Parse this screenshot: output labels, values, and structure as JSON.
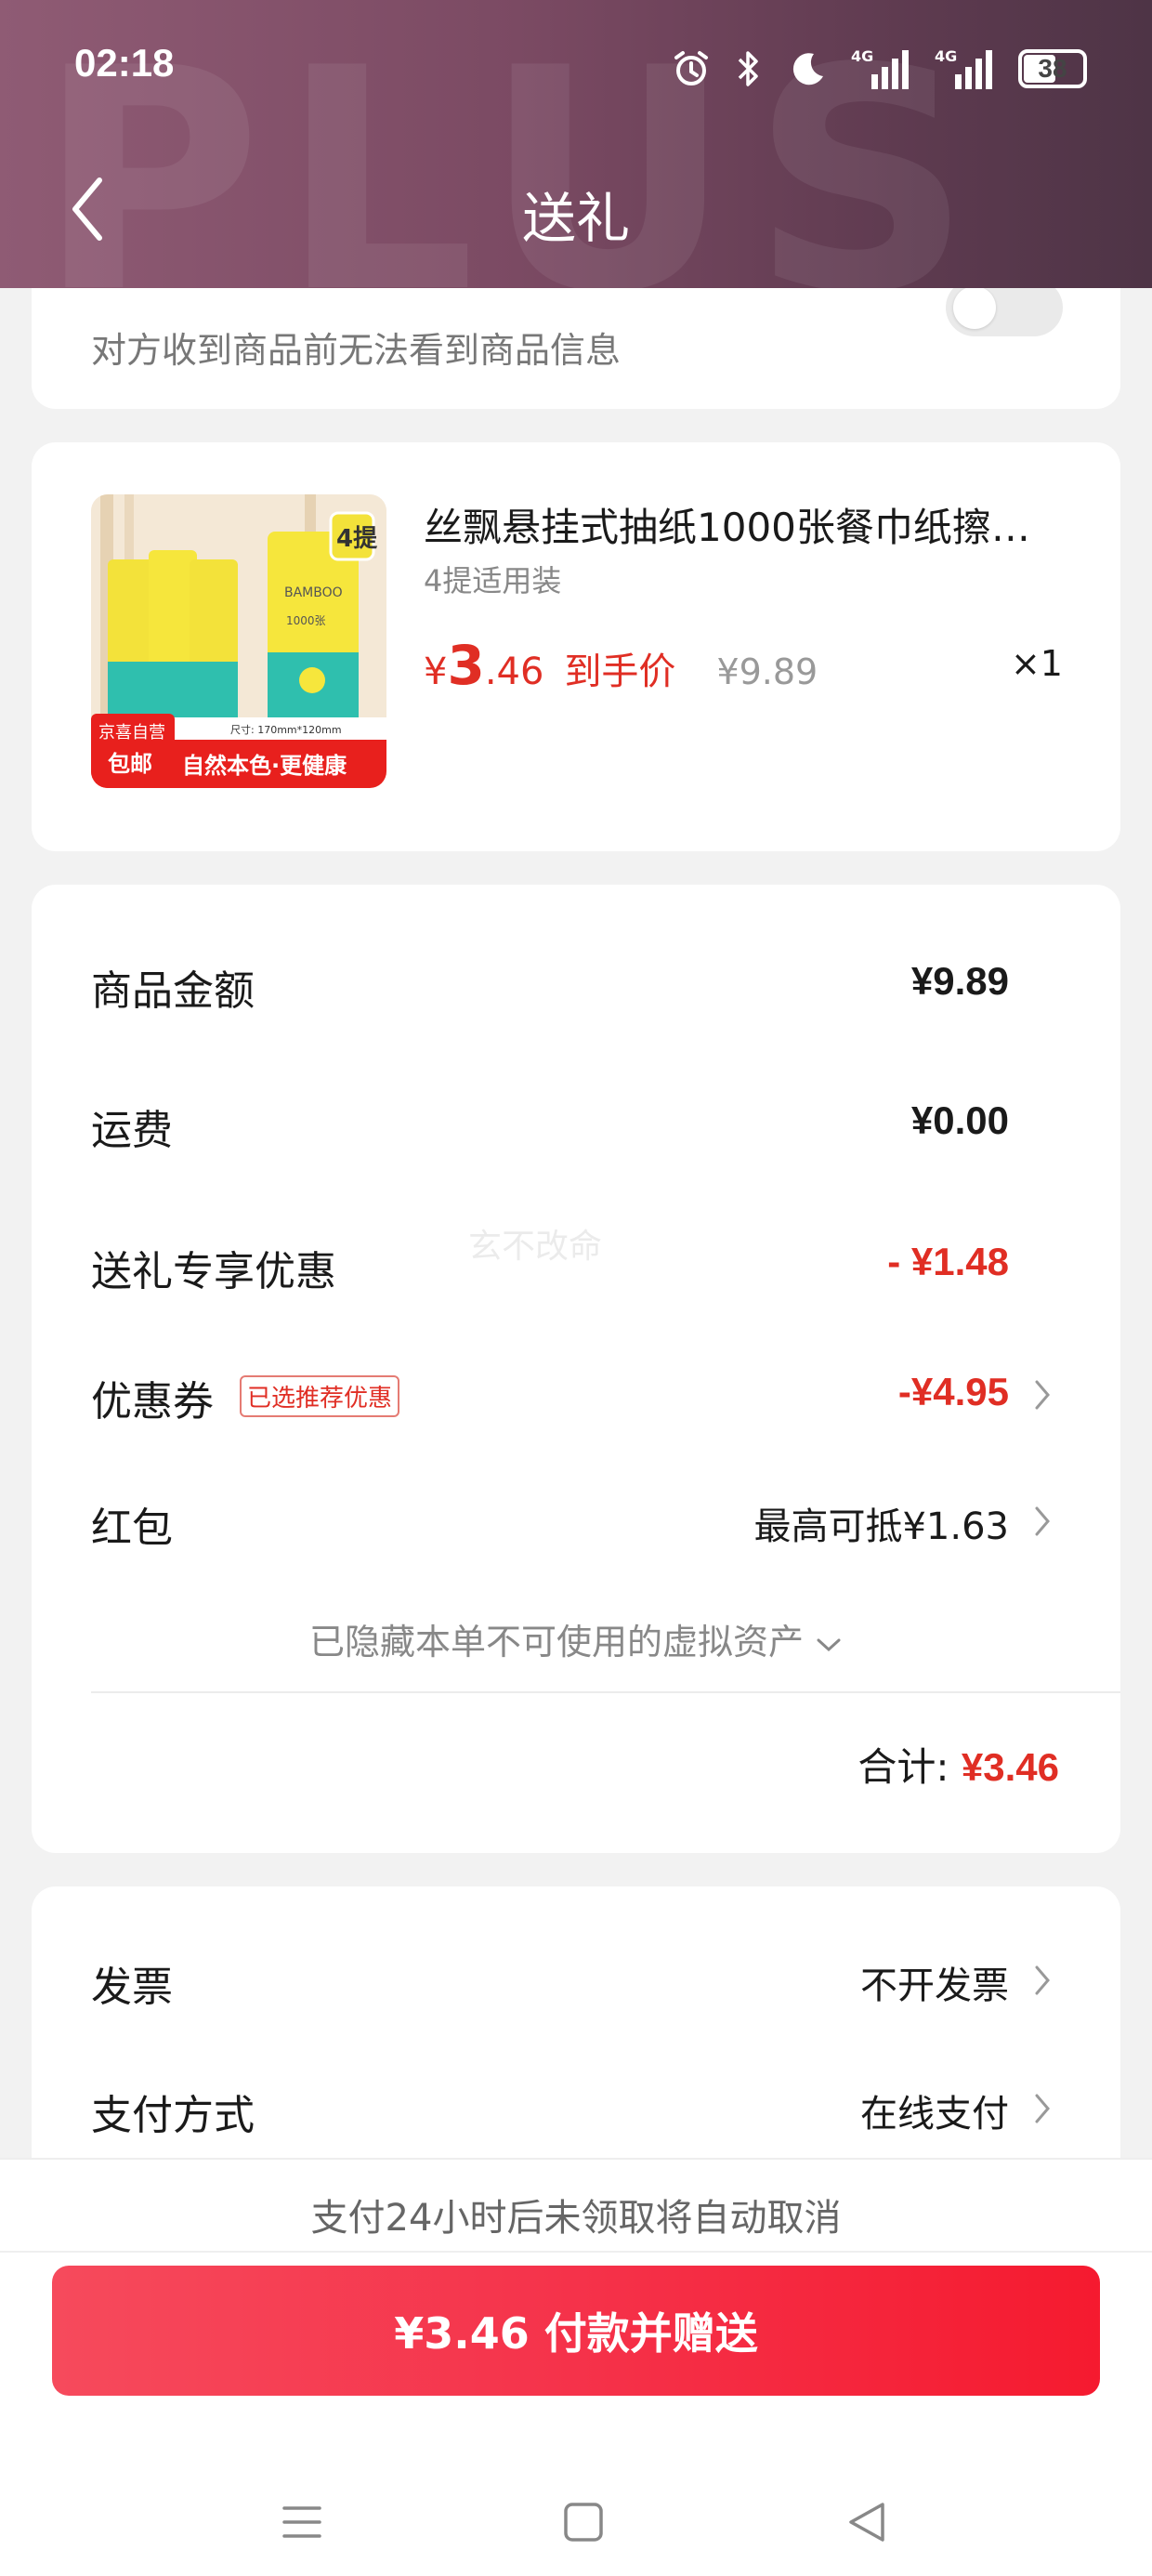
{
  "status_bar": {
    "time": "02:18",
    "network_1": "4G",
    "network_2": "4G",
    "battery": "38"
  },
  "header": {
    "title": "送礼",
    "watermark": "PLUS"
  },
  "privacy_card": {
    "hint": "对方收到商品前无法看到商品信息",
    "toggle_on": false
  },
  "product": {
    "name": "丝飘悬挂式抽纸1000张餐巾纸擦…",
    "spec": "4提适用装",
    "price_symbol": "¥",
    "price_int": "3",
    "price_dec": ".46",
    "price_label": "到手价",
    "original_price": "¥9.89",
    "quantity": "×1",
    "thumb": {
      "badge_pack": "4提",
      "badge_store": "京喜自营",
      "badge_ship": "包邮",
      "slogan": "自然本色·更健康",
      "size_text": "尺寸: 170mm*120mm",
      "brand_text": "BAMBOO",
      "count_text": "1000张"
    }
  },
  "summary": {
    "goods_amount": {
      "label": "商品金额",
      "value": "¥9.89"
    },
    "shipping": {
      "label": "运费",
      "value": "¥0.00"
    },
    "gift_discount": {
      "label": "送礼专享优惠",
      "value": "- ¥1.48"
    },
    "coupon": {
      "label": "优惠券",
      "tag": "已选推荐优惠",
      "value": "-¥4.95"
    },
    "red_packet": {
      "label": "红包",
      "value": "最高可抵¥1.63"
    },
    "hidden_assets": "已隐藏本单不可使用的虚拟资产",
    "total_label": "合计:",
    "total_value": "¥3.46",
    "watermark": "玄不改命"
  },
  "invoice": {
    "invoice_label": "发票",
    "invoice_value": "不开发票",
    "payment_label": "支付方式",
    "payment_value": "在线支付"
  },
  "bottom": {
    "cancel_hint": "支付24小时后未领取将自动取消",
    "pay_button": "¥3.46 付款并赠送"
  },
  "colors": {
    "accent_red": "#e02e24",
    "button_red": "#f5324a",
    "header_start": "#8f5b74",
    "header_end": "#4e3446"
  }
}
